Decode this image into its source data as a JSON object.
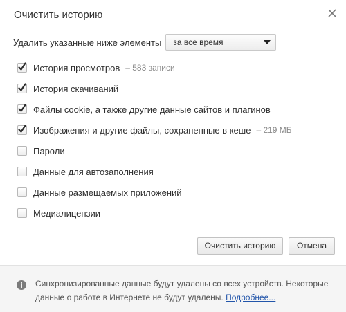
{
  "dialog": {
    "title": "Очистить историю"
  },
  "time_range": {
    "label": "Удалить указанные ниже элементы",
    "selected": "за все время"
  },
  "items": [
    {
      "label": "История просмотров",
      "extra": "–  583 записи",
      "checked": true
    },
    {
      "label": "История скачиваний",
      "extra": "",
      "checked": true
    },
    {
      "label": "Файлы cookie, а также другие данные сайтов и плагинов",
      "extra": "",
      "checked": true
    },
    {
      "label": "Изображения и другие файлы, сохраненные в кеше",
      "extra": "–  219 МБ",
      "checked": true
    },
    {
      "label": "Пароли",
      "extra": "",
      "checked": false
    },
    {
      "label": "Данные для автозаполнения",
      "extra": "",
      "checked": false
    },
    {
      "label": "Данные размещаемых приложений",
      "extra": "",
      "checked": false
    },
    {
      "label": "Медиалицензии",
      "extra": "",
      "checked": false
    }
  ],
  "buttons": {
    "confirm": "Очистить историю",
    "cancel": "Отмена"
  },
  "footer": {
    "text": "Синхронизированные данные будут удалены со всех устройств. Некоторые данные о работе в Интернете не будут удалены.",
    "link": "Подробнее..."
  },
  "icons": {
    "close": "close-icon",
    "dropdown": "chevron-down-icon",
    "info": "info-icon",
    "check": "checkmark-icon"
  }
}
